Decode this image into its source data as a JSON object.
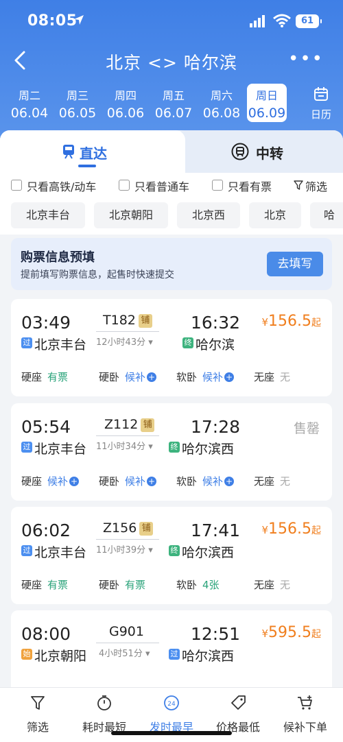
{
  "status_bar": {
    "time": "08:05",
    "battery": "61"
  },
  "nav": {
    "title": "北京 <> 哈尔滨"
  },
  "dates": [
    {
      "weekday": "周二",
      "date": "06.04"
    },
    {
      "weekday": "周三",
      "date": "06.05"
    },
    {
      "weekday": "周四",
      "date": "06.06"
    },
    {
      "weekday": "周五",
      "date": "06.07"
    },
    {
      "weekday": "周六",
      "date": "06.08"
    },
    {
      "weekday": "周日",
      "date": "06.09",
      "selected": true
    }
  ],
  "calendar_label": "日历",
  "tabs": {
    "direct": "直达",
    "transfer": "中转"
  },
  "filters": {
    "high_speed": "只看高铁/动车",
    "regular": "只看普通车",
    "available": "只看有票",
    "filter": "筛选"
  },
  "stations": [
    "北京丰台",
    "北京朝阳",
    "北京西",
    "北京",
    "哈"
  ],
  "promo": {
    "title": "购票信息预填",
    "subtitle": "提前填写购票信息，起售时快速提交",
    "button": "去填写"
  },
  "trains": [
    {
      "dep_time": "03:49",
      "arr_time": "16:32",
      "train_no": "T182",
      "tag": "铺",
      "duration": "12小时43分",
      "from_badge": "过",
      "from": "北京丰台",
      "to_badge": "终",
      "to": "哈尔滨",
      "price_symbol": "¥",
      "price": "156.5",
      "price_suffix": "起",
      "seats": [
        {
          "type": "硬座",
          "status": "有票"
        },
        {
          "type": "硬卧",
          "status": "候补"
        },
        {
          "type": "软卧",
          "status": "候补"
        },
        {
          "type": "无座",
          "status": "无"
        }
      ]
    },
    {
      "dep_time": "05:54",
      "arr_time": "17:28",
      "train_no": "Z112",
      "tag": "铺",
      "duration": "11小时34分",
      "from_badge": "过",
      "from": "北京丰台",
      "to_badge": "终",
      "to": "哈尔滨西",
      "sold_out": "售罄",
      "seats": [
        {
          "type": "硬座",
          "status": "候补"
        },
        {
          "type": "硬卧",
          "status": "候补"
        },
        {
          "type": "软卧",
          "status": "候补"
        },
        {
          "type": "无座",
          "status": "无"
        }
      ]
    },
    {
      "dep_time": "06:02",
      "arr_time": "17:41",
      "train_no": "Z156",
      "tag": "铺",
      "duration": "11小时39分",
      "from_badge": "过",
      "from": "北京丰台",
      "to_badge": "终",
      "to": "哈尔滨西",
      "price_symbol": "¥",
      "price": "156.5",
      "price_suffix": "起",
      "seats": [
        {
          "type": "硬座",
          "status": "有票"
        },
        {
          "type": "硬卧",
          "status": "有票"
        },
        {
          "type": "软卧",
          "status": "4张"
        },
        {
          "type": "无座",
          "status": "无"
        }
      ]
    },
    {
      "dep_time": "08:00",
      "arr_time": "12:51",
      "train_no": "G901",
      "duration": "4小时51分",
      "from_badge": "始",
      "from": "北京朝阳",
      "to_badge": "过",
      "to": "哈尔滨西",
      "price_symbol": "¥",
      "price": "595.5",
      "price_suffix": "起"
    }
  ],
  "bottom_bar": {
    "filter": "筛选",
    "shortest": "耗时最短",
    "earliest": "发时最早",
    "earliest_icon_text": "24",
    "cheapest": "价格最低",
    "waitlist": "候补下单"
  }
}
